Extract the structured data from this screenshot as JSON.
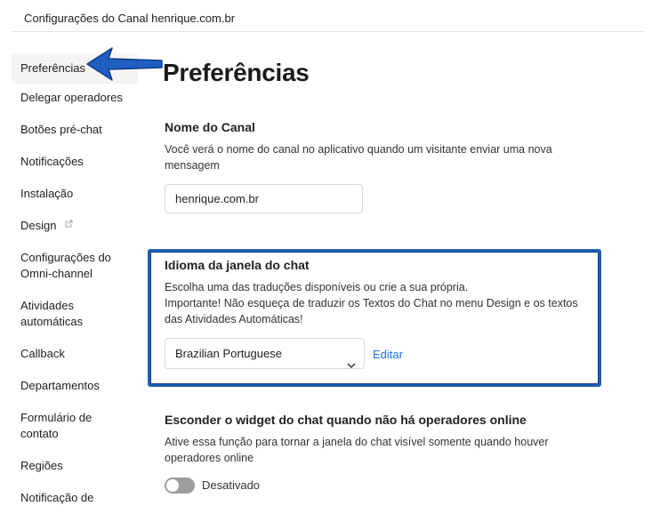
{
  "header": {
    "title": "Configurações do Canal henrique.com.br"
  },
  "sidebar": {
    "items": [
      {
        "label": "Preferências"
      },
      {
        "label": "Delegar operadores"
      },
      {
        "label": "Botões pré-chat"
      },
      {
        "label": "Notificações"
      },
      {
        "label": "Instalação"
      },
      {
        "label": "Design"
      },
      {
        "label": "Configurações do",
        "label2": "Omni-channel"
      },
      {
        "label": "Atividades",
        "label2": "automáticas"
      },
      {
        "label": "Callback"
      },
      {
        "label": "Departamentos"
      },
      {
        "label": "Formulário de",
        "label2": "contato"
      },
      {
        "label": "Regiões"
      },
      {
        "label": "Notificação de"
      }
    ]
  },
  "main": {
    "page_title": "Preferências",
    "channel_name": {
      "title": "Nome do Canal",
      "desc_line1": "Você verá o nome do canal no aplicativo quando um visitante enviar uma nova",
      "desc_line2": "mensagem",
      "value": "henrique.com.br"
    },
    "language": {
      "title": "Idioma da janela do chat",
      "desc_line1": "Escolha uma das traduções disponíveis ou crie a sua própria.",
      "desc_line2": "Importante! Não esqueça de traduzir os Textos do Chat no menu Design e os textos",
      "desc_line3": "das Atividades Automáticas!",
      "selected": "Brazilian Portuguese",
      "edit_label": "Editar"
    },
    "hide_widget": {
      "title": "Esconder o widget do chat quando não há operadores online",
      "desc_line1": "Ative essa função para tornar a janela do chat visível somente quando houver",
      "desc_line2": "operadores online",
      "status": "Desativado"
    }
  },
  "colors": {
    "accent": "#1a6ed8",
    "highlight_border": "#1c5fb5",
    "arrow": "#1f5fc0"
  }
}
